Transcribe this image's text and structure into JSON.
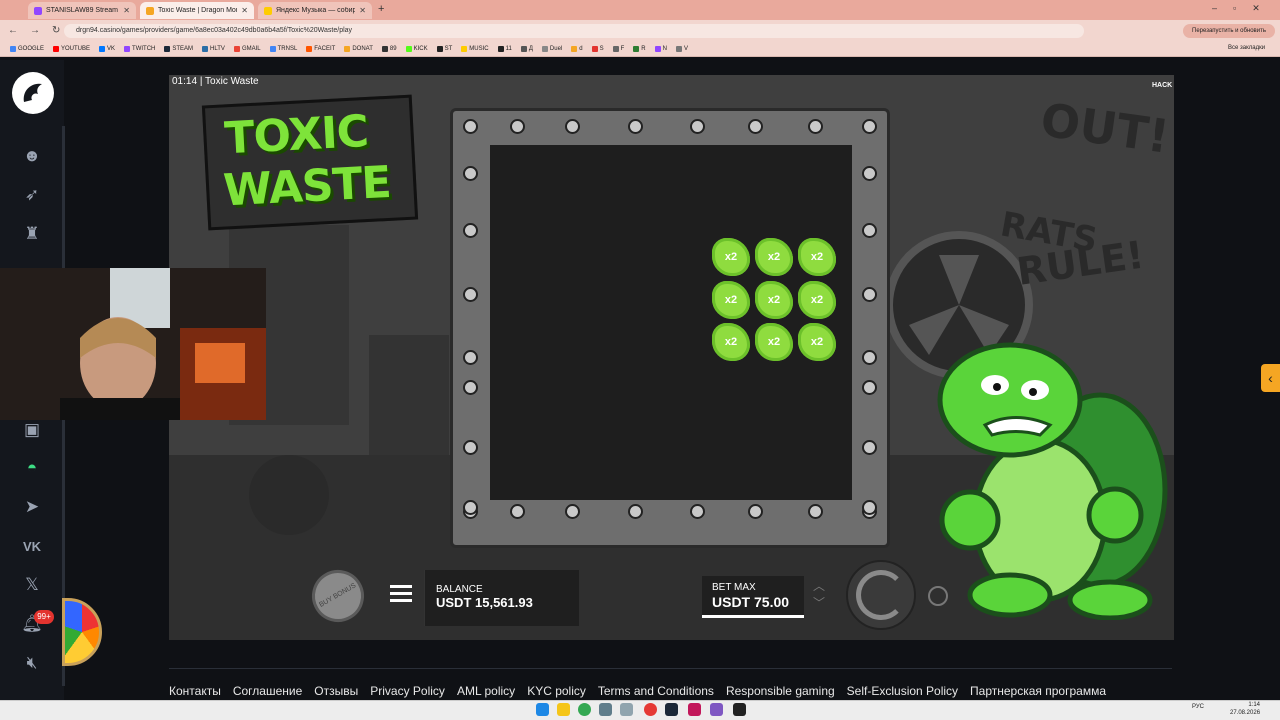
{
  "browser": {
    "tabs": [
      {
        "title": "STANISLAW89 Stream - Watch ...",
        "color": "#9146ff"
      },
      {
        "title": "Toxic Waste | Dragon Mone...",
        "color": "#f5a623"
      },
      {
        "title": "Яндекс Музыка — собирае...",
        "color": "#ffcc00"
      }
    ],
    "url": "drgn94.casino/games/providers/game/6a8ec03a402c49db0a6b4a5f/Toxic%20Waste/play",
    "restart_label": "Перезапустить и обновить",
    "bookmarks": [
      {
        "label": "GOOGLE",
        "color": "#4285f4"
      },
      {
        "label": "YOUTUBE",
        "color": "#ff0000"
      },
      {
        "label": "VK",
        "color": "#0077ff"
      },
      {
        "label": "TWITCH",
        "color": "#9146ff"
      },
      {
        "label": "STEAM",
        "color": "#1b2838"
      },
      {
        "label": "HLTV",
        "color": "#2b6ea6"
      },
      {
        "label": "GMAIL",
        "color": "#ea4335"
      },
      {
        "label": "TRNSL",
        "color": "#4285f4"
      },
      {
        "label": "FACEIT",
        "color": "#ff5500"
      },
      {
        "label": "DONAT",
        "color": "#f5a623"
      },
      {
        "label": "89",
        "color": "#333333"
      },
      {
        "label": "KICK",
        "color": "#53fc18"
      },
      {
        "label": "ST",
        "color": "#222222"
      },
      {
        "label": "MUSIC",
        "color": "#ffcc00"
      },
      {
        "label": "11",
        "color": "#222222"
      },
      {
        "label": "Д",
        "color": "#555555"
      },
      {
        "label": "Duel",
        "color": "#888888"
      },
      {
        "label": "d",
        "color": "#f5a623"
      },
      {
        "label": "S",
        "color": "#e3342f"
      },
      {
        "label": "F",
        "color": "#666666"
      },
      {
        "label": "R",
        "color": "#2e7d32"
      },
      {
        "label": "N",
        "color": "#9146ff"
      },
      {
        "label": "V",
        "color": "#777777"
      }
    ],
    "all_bookmarks": "Все закладки"
  },
  "game": {
    "timer": "01:14",
    "separator": "|",
    "name": "Toxic Waste",
    "logo_line1": "TOXIC",
    "logo_line2": "WASTE",
    "multiplier_symbol": "x2",
    "buy_bonus_label": "BUY BONUS",
    "balance_label": "BALANCE",
    "balance_value": "USDT 15,561.93",
    "bet_label": "BET MAX",
    "bet_value": "USDT 75.00",
    "provider_badge": "HACK"
  },
  "sidebar": {
    "icons": [
      "smile-icon",
      "rocket-icon",
      "trophy-icon",
      "gift-icon",
      "headset-icon",
      "telegram-icon",
      "vk-icon",
      "x-icon",
      "bell-icon",
      "mute-icon"
    ],
    "notification_count": "99+"
  },
  "footer": {
    "links": [
      "Контакты",
      "Соглашение",
      "Отзывы",
      "Privacy Policy",
      "AML policy",
      "KYC policy",
      "Terms and Conditions",
      "Responsible gaming",
      "Self-Exclusion Policy",
      "Партнерская программа"
    ]
  },
  "taskbar": {
    "time": "1:14",
    "date": "27.08.2026",
    "lang": "РУС"
  }
}
